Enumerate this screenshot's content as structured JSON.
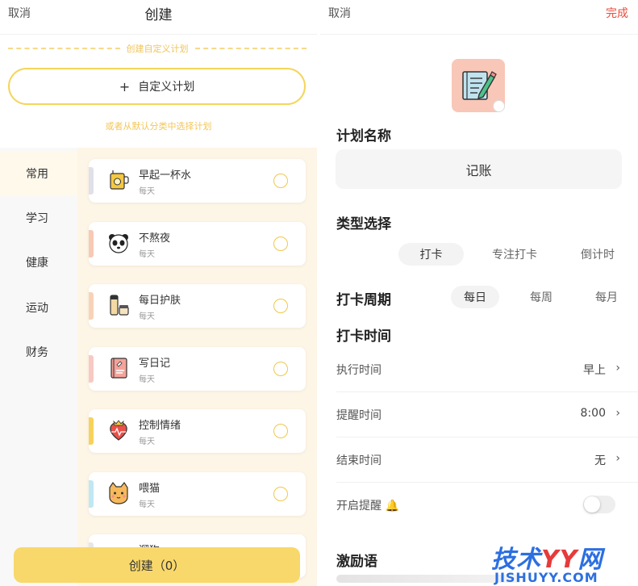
{
  "left": {
    "cancel": "取消",
    "title": "创建",
    "custom_section_label": "创建自定义计划",
    "custom_plan_plus": "+",
    "custom_plan_label": "自定义计划",
    "choose_hint": "或者从默认分类中选择计划",
    "categories": [
      "常用",
      "学习",
      "健康",
      "运动",
      "财务"
    ],
    "active_category": "常用",
    "plans": [
      {
        "name": "早起一杯水",
        "freq": "每天",
        "icon": "cup-icon",
        "color": "#e0e0ea"
      },
      {
        "name": "不熬夜",
        "freq": "每天",
        "icon": "panda-icon",
        "color": "#f8c9b4"
      },
      {
        "name": "每日护肤",
        "freq": "每天",
        "icon": "skincare-icon",
        "color": "#f8d2b8"
      },
      {
        "name": "写日记",
        "freq": "每天",
        "icon": "diary-icon",
        "color": "#f8c9c4"
      },
      {
        "name": "控制情绪",
        "freq": "每天",
        "icon": "heart-icon",
        "color": "#f7d25a"
      },
      {
        "name": "喂猫",
        "freq": "每天",
        "icon": "cat-icon",
        "color": "#bfe7f4"
      },
      {
        "name": "遛狗",
        "freq": "",
        "icon": "dog-icon",
        "color": "#e6e6e6"
      }
    ],
    "create_button": "创建（0）"
  },
  "right": {
    "cancel": "取消",
    "done": "完成",
    "plan_icon": "notebook-pencil-icon",
    "name_section": "计划名称",
    "name_value": "记账",
    "type_section": "类型选择",
    "types": [
      "打卡",
      "专注打卡",
      "倒计时"
    ],
    "active_type": "打卡",
    "period_section": "打卡周期",
    "periods": [
      "每日",
      "每周",
      "每月"
    ],
    "active_period": "每日",
    "time_section": "打卡时间",
    "rows": [
      {
        "label": "执行时间",
        "value": "早上"
      },
      {
        "label": "提醒时间",
        "value": "8:00"
      },
      {
        "label": "结束时间",
        "value": "无"
      }
    ],
    "reminder_label": "开启提醒 🔔",
    "reminder_on": false,
    "motto_section": "激励语"
  },
  "watermark": {
    "main_a": "技术",
    "main_b": "YY",
    "main_c": "网",
    "sub": "JISHUYY.COM"
  },
  "colors": {
    "accent_yellow": "#f8d86a",
    "done_red": "#e94b3c",
    "watermark_blue": "#2c6fe0"
  }
}
